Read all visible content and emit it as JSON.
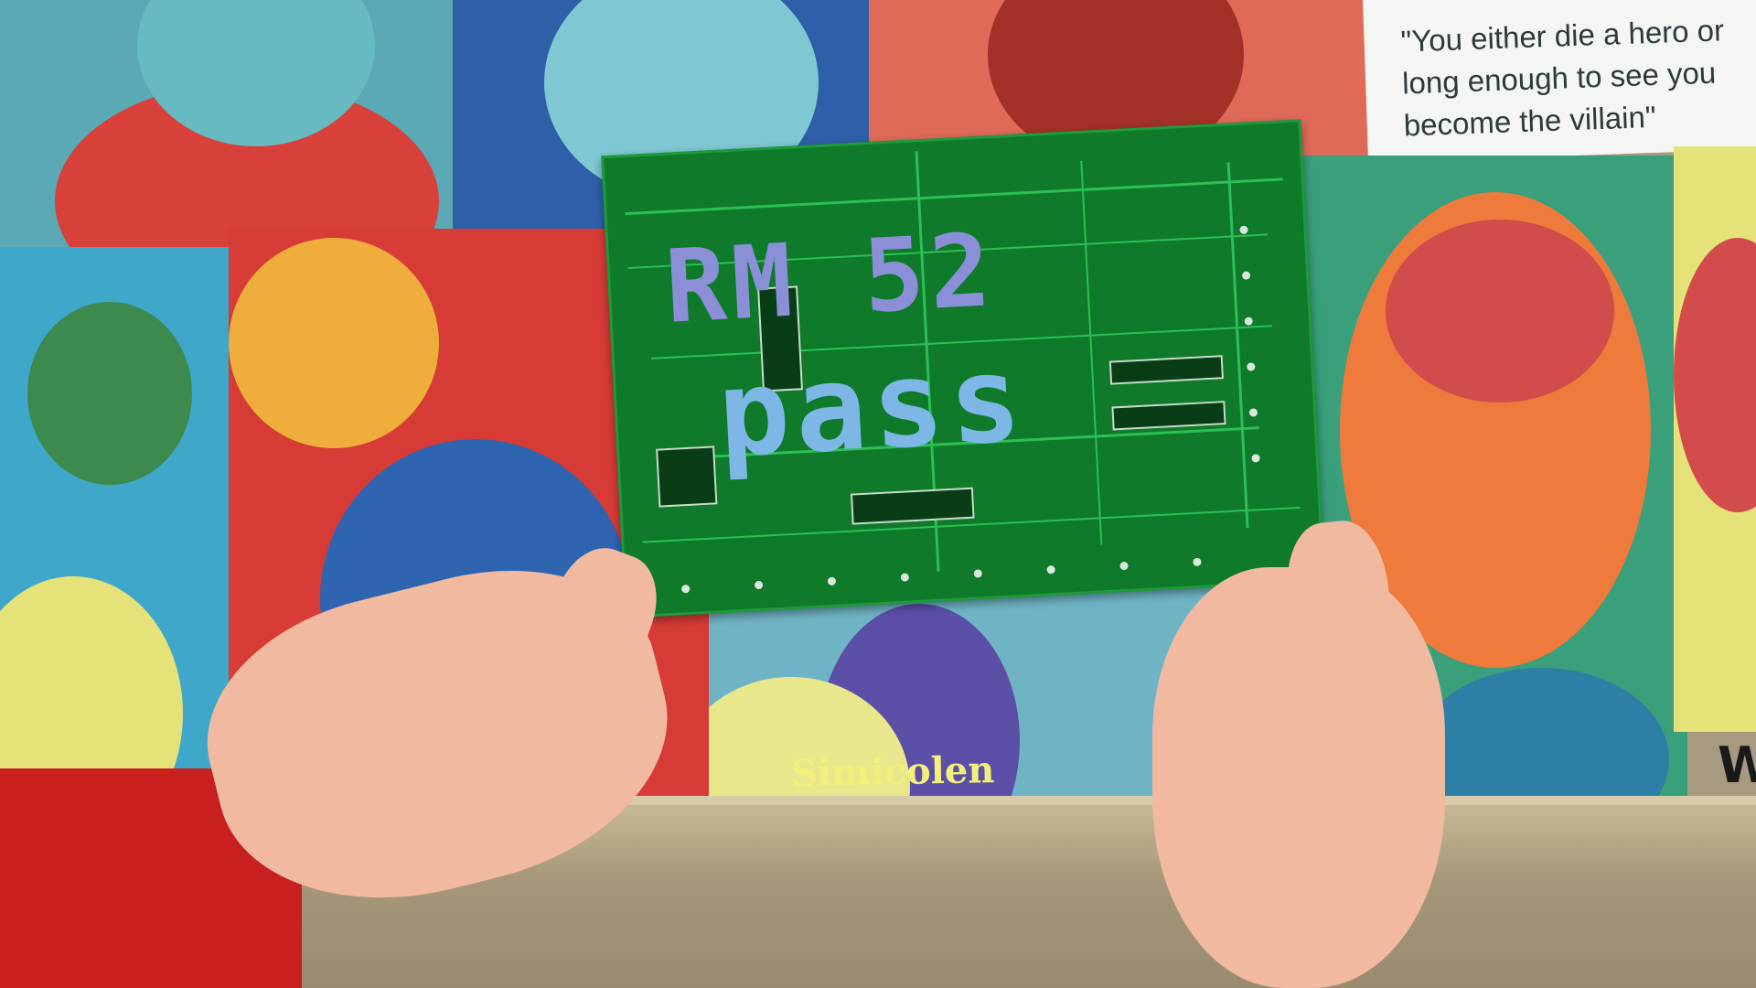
{
  "scene": {
    "description_free": true,
    "posters": {
      "quote_lines": [
        "\"You either die a hero or",
        "long enough to see you",
        "become the villain\""
      ],
      "poster_name": "Simicolen",
      "cut_letter": "W"
    },
    "board": {
      "overlay_line1": "RM 52",
      "overlay_line2": "pass"
    }
  },
  "colors": {
    "pcb_green": "#0f7a2a",
    "overlay_purple": "#8a8fd8",
    "overlay_cyan": "#6cc7e8",
    "sleeve_red": "#c8201f"
  }
}
